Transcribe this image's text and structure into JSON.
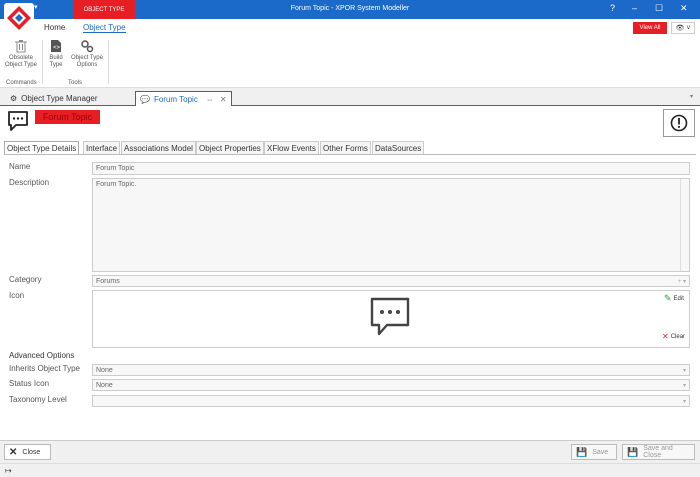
{
  "titlebar": {
    "context_tab": "OBJECT TYPE",
    "title": "Forum Topic - XPOR System Modeller",
    "help": "?",
    "minimize": "–",
    "maximize": "☐",
    "close": "✕"
  },
  "ribbon": {
    "tabs": [
      "Home",
      "Object Type"
    ],
    "view_all": "View All",
    "eye": "👁 ˅",
    "buttons": {
      "obsolete": "Obsolete Object Type",
      "build": "Build Type",
      "options": "Object Type Options"
    },
    "groups": [
      "Commands",
      "Tools"
    ]
  },
  "doc_tabs": [
    "Object Type Manager",
    "Forum Topic"
  ],
  "object": {
    "title": "Forum Topic"
  },
  "sub_tabs": [
    "Object Type Details",
    "Interface",
    "Associations Model",
    "Object Properties",
    "XFlow Events",
    "Other Forms",
    "DataSources"
  ],
  "form": {
    "name_label": "Name",
    "name_value": "Forum Topic",
    "description_label": "Description",
    "description_value": "Forum Topic.",
    "category_label": "Category",
    "category_value": "Forums",
    "icon_label": "Icon",
    "edit_label": "Edit",
    "clear_label": "Clear",
    "advanced_label": "Advanced Options",
    "inherits_label": "Inherits Object Type",
    "inherits_value": "None",
    "status_icon_label": "Status Icon",
    "status_icon_value": "None",
    "taxonomy_label": "Taxonomy Level",
    "taxonomy_value": ""
  },
  "bottom": {
    "close": "Close",
    "save": "Save",
    "save_close": "Save and Close"
  },
  "colors": {
    "accent": "#1b6ac9",
    "brand_red": "#e81e25"
  }
}
